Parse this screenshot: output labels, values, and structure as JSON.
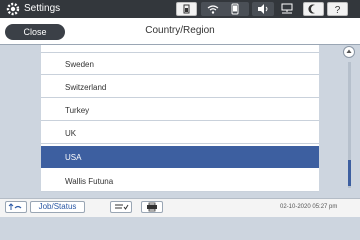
{
  "topbar": {
    "title": "Settings",
    "icons": [
      "gear-icon",
      "device-status-icon",
      "wifi-icon",
      "phone-icon",
      "speaker-icon",
      "network-icon",
      "moon-icon",
      "help-icon"
    ]
  },
  "header": {
    "close_label": "Close",
    "title": "Country/Region"
  },
  "list": {
    "items": [
      {
        "label": "Sweden"
      },
      {
        "label": "Switzerland"
      },
      {
        "label": "Turkey"
      },
      {
        "label": "UK"
      },
      {
        "label": "USA",
        "selected": true
      },
      {
        "label": "Wallis Futuna"
      }
    ]
  },
  "bottombar": {
    "job_status_label": "Job/Status",
    "datetime": "02-10-2020 05:27 pm"
  },
  "colors": {
    "selected_row": "#3d5fa0",
    "topbar": "#33373c",
    "background": "#cdd5df"
  }
}
